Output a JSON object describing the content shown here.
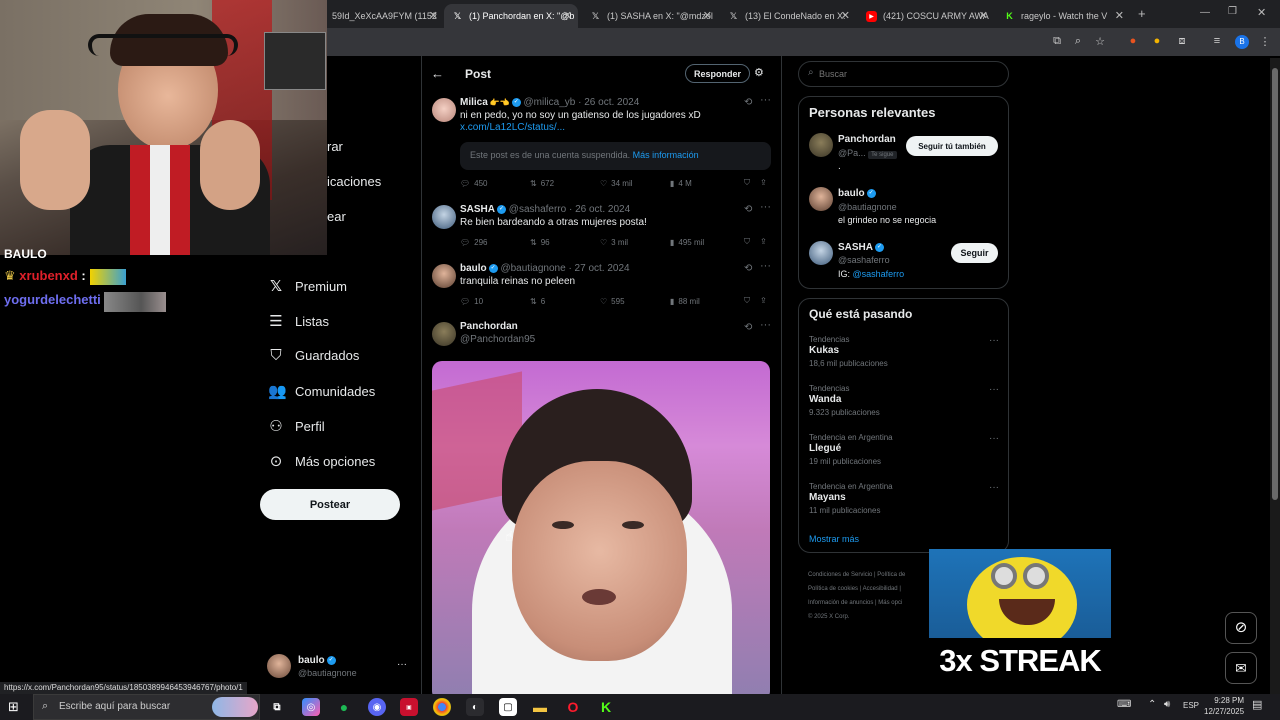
{
  "browser": {
    "tabs": [
      {
        "label": "59Id_XeXcAA9FYM (1152",
        "icon": "image-icon"
      },
      {
        "label": "(1) Panchordan en X: \"@b",
        "icon": "x-logo-icon",
        "active": true
      },
      {
        "label": "(1) SASHA en X: \"@mdzol",
        "icon": "x-logo-icon"
      },
      {
        "label": "(13) El CondeNado en X:",
        "icon": "x-logo-icon"
      },
      {
        "label": "(421) COSCU ARMY AWA",
        "icon": "youtube-icon"
      },
      {
        "label": "rageylo - Watch the V",
        "icon": "kick-icon"
      }
    ],
    "status_url": "https://x.com/Panchordan95/status/1850389946453946767/photo/1"
  },
  "overlay": {
    "chat": [
      {
        "user": "xrubenxd",
        "sep": ":",
        "color": "#e0202a"
      },
      {
        "user": "yogurdelechetti",
        "sep": ":",
        "color": "#6e6ef0"
      }
    ],
    "header_partial": "BAULO",
    "nav_partials": [
      "rar",
      "icaciones",
      "ear"
    ],
    "streak_text": "3x STREAK"
  },
  "sidebar": {
    "items": [
      {
        "label": "Premium",
        "icon": "x-logo-icon"
      },
      {
        "label": "Listas",
        "icon": "list-icon"
      },
      {
        "label": "Guardados",
        "icon": "bookmark-icon"
      },
      {
        "label": "Comunidades",
        "icon": "communities-icon"
      },
      {
        "label": "Perfil",
        "icon": "person-icon"
      },
      {
        "label": "Más opciones",
        "icon": "more-circle-icon"
      }
    ],
    "post_button": "Postear",
    "account": {
      "name": "baulo",
      "handle": "@bautiagnone",
      "more": "···"
    }
  },
  "main": {
    "header": {
      "title": "Post",
      "reply_button": "Responder"
    },
    "tweets": [
      {
        "name": "Milica",
        "handle": "@milica_yb",
        "date": "· 26 oct. 2024",
        "text": "ni en pedo, yo no soy un gatienso de los jugadores xD",
        "link": "x.com/La12LC/status/...",
        "suspended": "Este post es de una cuenta suspendida.",
        "suspended_link": "Más información",
        "replies": "450",
        "reposts": "672",
        "likes": "34 mil",
        "views": "4 M"
      },
      {
        "name": "SASHA",
        "handle": "@sashaferro",
        "date": "· 26 oct. 2024",
        "text": "Re bien bardeando a otras mujeres posta!",
        "replies": "296",
        "reposts": "96",
        "likes": "3 mil",
        "views": "495 mil"
      },
      {
        "name": "baulo",
        "handle": "@bautiagnone",
        "date": "· 27 oct. 2024",
        "text": "tranquila reinas no peleen",
        "replies": "10",
        "reposts": "6",
        "likes": "595",
        "views": "88 mil"
      },
      {
        "name": "Panchordan",
        "handle": "@Panchordan95"
      }
    ]
  },
  "right": {
    "search_placeholder": "Buscar",
    "relevant": {
      "title": "Personas relevantes",
      "people": [
        {
          "name": "Panchordan",
          "handle": "@Pa...",
          "badge": "Te sigue",
          "bio": ".",
          "button": "Seguir tú también"
        },
        {
          "name": "baulo",
          "handle": "@bautiagnone",
          "bio": "el grindeo no se negocia"
        },
        {
          "name": "SASHA",
          "handle": "@sashaferro",
          "bio_prefix": "IG: ",
          "bio_link": "@sashaferro",
          "button": "Seguir"
        }
      ]
    },
    "trends": {
      "title": "Qué está pasando",
      "items": [
        {
          "category": "Tendencias",
          "name": "Kukas",
          "count": "18,6 mil publicaciones"
        },
        {
          "category": "Tendencias",
          "name": "Wanda",
          "count": "9.323 publicaciones"
        },
        {
          "category": "Tendencia en Argentina",
          "name": "Llegué",
          "count": "19 mil publicaciones"
        },
        {
          "category": "Tendencia en Argentina",
          "name": "Mayans",
          "count": "11 mil publicaciones"
        }
      ],
      "show_more": "Mostrar más"
    },
    "footer": {
      "line1": [
        "Condiciones de Servicio",
        "|",
        "Política de"
      ],
      "line2": [
        "Política de cookies",
        "|",
        "Accesibilidad",
        "|"
      ],
      "line3": [
        "Información de anuncios",
        "|",
        "Más opci"
      ],
      "copyright": "© 2025 X Corp."
    }
  },
  "taskbar": {
    "search_placeholder": "Escribe aquí para buscar",
    "lang": "ESP",
    "time": "9:28 PM",
    "date": "12/27/2025"
  },
  "colors": {
    "accent": "#1d9bf0",
    "bg": "#000000",
    "border": "#2f3336",
    "muted": "#71767b"
  }
}
